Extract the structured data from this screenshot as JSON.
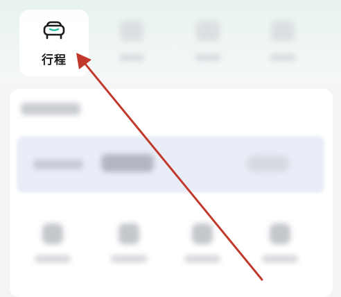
{
  "nav": {
    "active_tab": {
      "label": "行程",
      "icon": "car-icon",
      "color": "#1c1c1c"
    },
    "other_tab_icons": [
      "blurred-icon",
      "blurred-icon",
      "blurred-icon"
    ]
  },
  "annotation": {
    "type": "arrow",
    "color": "#c0392b",
    "points_to": "行程"
  },
  "colors": {
    "background": "#f4f5f7",
    "card": "#ffffff",
    "arrow": "#c0392b"
  }
}
